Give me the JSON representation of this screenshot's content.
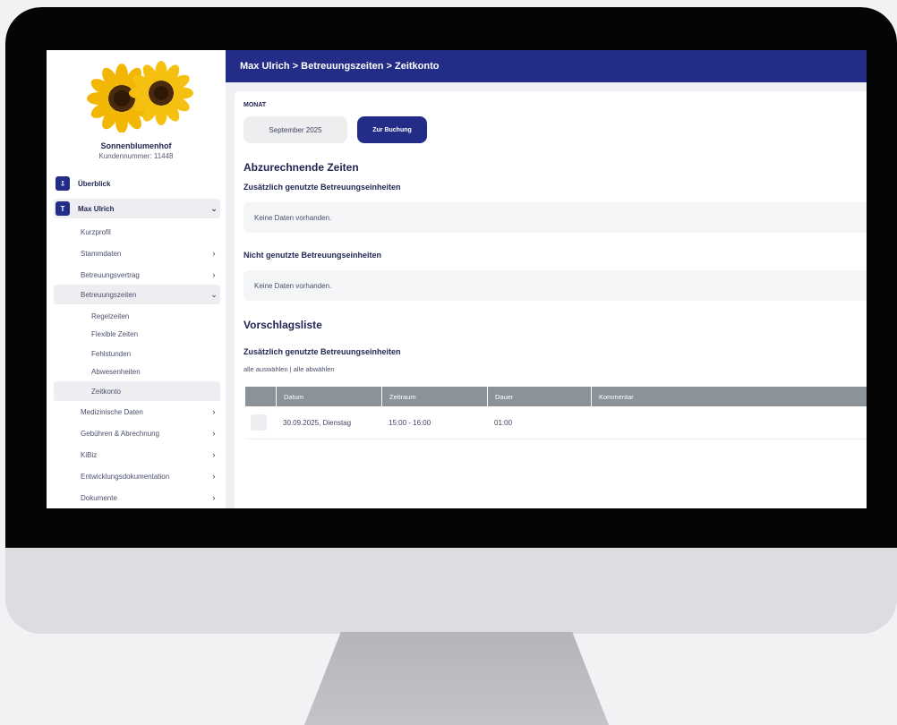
{
  "colors": {
    "primary": "#232c86",
    "table_header": "#8b9399",
    "bezel": "#050505"
  },
  "header": {
    "breadcrumb": "Max Ulrich > Betreuungszeiten > Zeitkonto"
  },
  "sidebar": {
    "org_name": "Sonnenblumenhof",
    "customer_number": "Kundennummer: 11448",
    "items": [
      {
        "label": "Überblick",
        "badge": "⇩",
        "icon": "download-icon"
      },
      {
        "label": "Max Ulrich",
        "badge": "T",
        "arrow": "⌄"
      },
      {
        "label": "Kurzprofil"
      },
      {
        "label": "Stammdaten",
        "arrow": "›"
      },
      {
        "label": "Betreuungsvertrag",
        "arrow": "›"
      },
      {
        "label": "Betreuungszeiten",
        "arrow": "⌄"
      },
      {
        "label": "Regelzeiten"
      },
      {
        "label": "Flexible Zeiten"
      },
      {
        "label": "Fehlstunden"
      },
      {
        "label": "Abwesenheiten"
      },
      {
        "label": "Zeitkonto"
      },
      {
        "label": "Medizinische Daten",
        "arrow": "›"
      },
      {
        "label": "Gebühren & Abrechnung",
        "arrow": "›"
      },
      {
        "label": "KiBiz",
        "arrow": "›"
      },
      {
        "label": "Entwicklungsdokumentation",
        "arrow": "›"
      },
      {
        "label": "Dokumente",
        "arrow": "›"
      }
    ]
  },
  "main": {
    "month_label": "MONAT",
    "month_value": "September 2025",
    "booking_button": "Zur Buchung",
    "section1_title": "Abzurechnende Zeiten",
    "section1_sub1": "Zusätzlich genutzte Betreuungseinheiten",
    "section1_nodata1": "Keine Daten vorhanden.",
    "section1_sub2": "Nicht genutzte Betreuungseinheiten",
    "section1_nodata2": "Keine Daten vorhanden.",
    "section2_title": "Vorschlagsliste",
    "section2_sub": "Zusätzlich genutzte Betreuungseinheiten",
    "select_links": "alle auswählen | alle abwählen",
    "table": {
      "columns": [
        "Datum",
        "Zeitraum",
        "Dauer",
        "Kommentar"
      ],
      "rows": [
        {
          "datum": "30.09.2025, Dienstag",
          "zeitraum": "15:00 - 16:00",
          "dauer": "01:00",
          "kommentar": ""
        }
      ]
    }
  }
}
